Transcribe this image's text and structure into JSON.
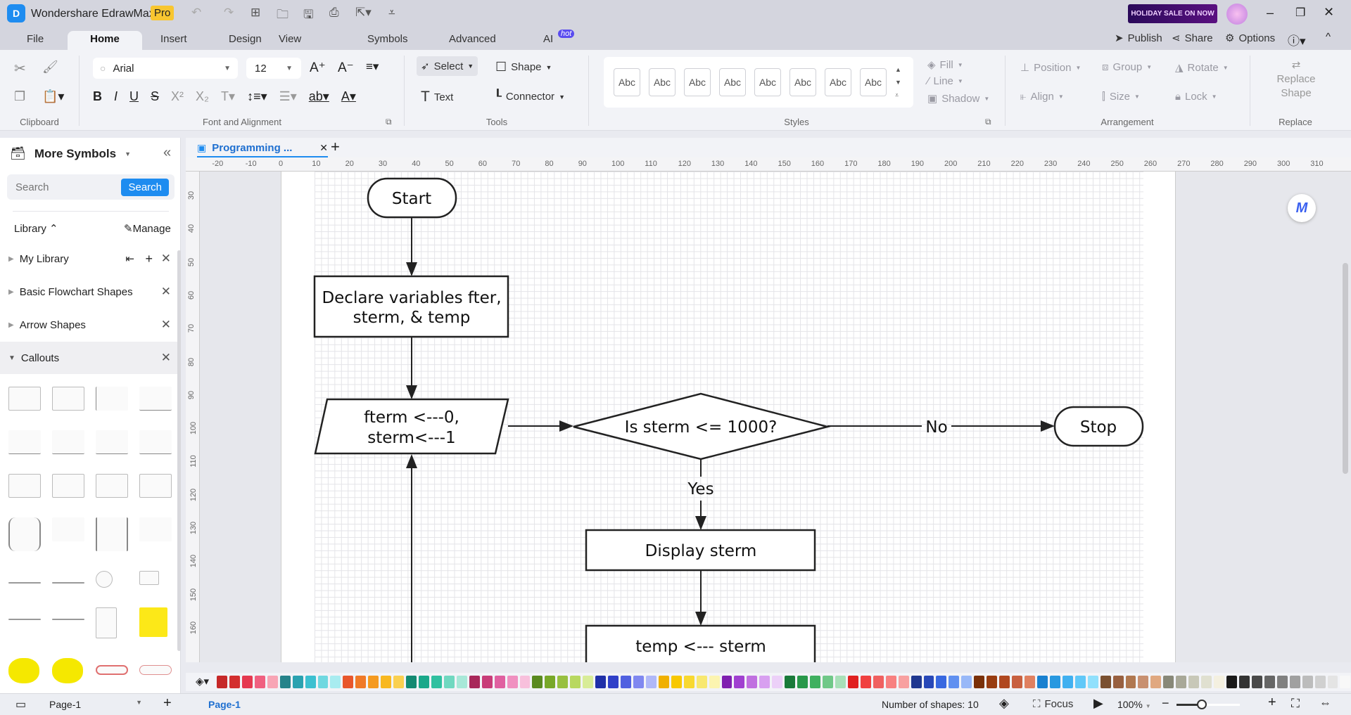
{
  "app": {
    "name": "Wondershare EdrawMax",
    "badge": "Pro",
    "promo": "HOLIDAY SALE ON NOW"
  },
  "menu_tabs": [
    "File",
    "Home",
    "Insert",
    "Design",
    "View",
    "Symbols",
    "Advanced",
    "AI"
  ],
  "ai_badge": "hot",
  "top_actions": {
    "publish": "Publish",
    "share": "Share",
    "options": "Options"
  },
  "ribbon": {
    "font": "Arial",
    "font_size": "12",
    "select": "Select",
    "shape": "Shape",
    "text": "Text",
    "connector": "Connector",
    "styles": [
      "Abc",
      "Abc",
      "Abc",
      "Abc",
      "Abc",
      "Abc",
      "Abc",
      "Abc"
    ],
    "fill": "Fill",
    "line": "Line",
    "shadow": "Shadow",
    "position": "Position",
    "group": "Group",
    "rotate": "Rotate",
    "align": "Align",
    "size": "Size",
    "lock": "Lock",
    "replace_shape_1": "Replace",
    "replace_shape_2": "Shape",
    "groups": {
      "clipboard": "Clipboard",
      "font": "Font and Alignment",
      "tools": "Tools",
      "styles": "Styles",
      "arrangement": "Arrangement",
      "replace": "Replace"
    }
  },
  "sidebar": {
    "title": "More Symbols",
    "search_placeholder": "Search",
    "search_button": "Search",
    "library": "Library",
    "manage": "Manage",
    "libraries": [
      "My Library",
      "Basic Flowchart Shapes",
      "Arrow Shapes",
      "Callouts"
    ]
  },
  "document": {
    "tab": "Programming ..."
  },
  "rulers": {
    "h": [
      -20,
      -10,
      0,
      10,
      20,
      30,
      40,
      50,
      60,
      70,
      80,
      90,
      100,
      110,
      120,
      130,
      140,
      150,
      160,
      170,
      180,
      190,
      200,
      210,
      220,
      230,
      240,
      250,
      260,
      270,
      280,
      290,
      300,
      310
    ],
    "v": [
      30,
      40,
      50,
      60,
      70,
      80,
      90,
      100,
      110,
      120,
      130,
      140,
      150,
      160
    ]
  },
  "flowchart": {
    "start": "Start",
    "declare_1": "Declare variables fter,",
    "declare_2": "sterm, & temp",
    "init_1": "fterm <---0,",
    "init_2": "sterm<---1",
    "decision": "Is sterm <= 1000?",
    "no": "No",
    "yes": "Yes",
    "stop": "Stop",
    "display": "Display sterm",
    "temp": "temp <--- sterm"
  },
  "palette": [
    "#c62828",
    "#d32f2f",
    "#e53950",
    "#f06080",
    "#f8a5b5",
    "#26838a",
    "#2aa2b0",
    "#3cc0d0",
    "#6fd8e0",
    "#a8ecf0",
    "#e8572c",
    "#f07a28",
    "#f59a20",
    "#f8b820",
    "#fad050",
    "#138a72",
    "#1aa88a",
    "#30c0a0",
    "#70d8c0",
    "#a8e8d8",
    "#a8285a",
    "#c83c78",
    "#e060a0",
    "#f090c0",
    "#f8c0dc",
    "#5a8a20",
    "#78a828",
    "#98c040",
    "#b8d860",
    "#d8ec98",
    "#2030a8",
    "#3040c8",
    "#5060e0",
    "#8088f0",
    "#b0b8f8",
    "#f0b000",
    "#f8c800",
    "#f8d830",
    "#f8e870",
    "#fcf4b0",
    "#8020b0",
    "#a040d0",
    "#c070e0",
    "#d8a0f0",
    "#ecd0f8",
    "#1a7a3a",
    "#28984a",
    "#40b060",
    "#70c888",
    "#a8e0b8",
    "#e02020",
    "#f04040",
    "#f06060",
    "#f88080",
    "#f8a0a0",
    "#203890",
    "#2848b8",
    "#3868e0",
    "#6090f0",
    "#98b8f8",
    "#7a3008",
    "#983c10",
    "#b04820",
    "#c86040",
    "#e08060",
    "#1880d0",
    "#2898e0",
    "#40b0f0",
    "#60c8f8",
    "#90e0fc",
    "#7a5030",
    "#986040",
    "#b07850",
    "#c89070",
    "#e0a880",
    "#888878",
    "#a8a898",
    "#c8c8b8",
    "#e0e0d0",
    "#f4f0e0",
    "#1a1a1a",
    "#333333",
    "#4a4a4a",
    "#666666",
    "#808080",
    "#a0a0a0",
    "#bcbcbc",
    "#d0d0d0",
    "#e4e4e4",
    "#f8f8f8"
  ],
  "status": {
    "page_select": "Page-1",
    "page_tab": "Page-1",
    "shapes": "Number of shapes: 10",
    "focus": "Focus",
    "zoom": "100%",
    "zoom_level": 100
  }
}
